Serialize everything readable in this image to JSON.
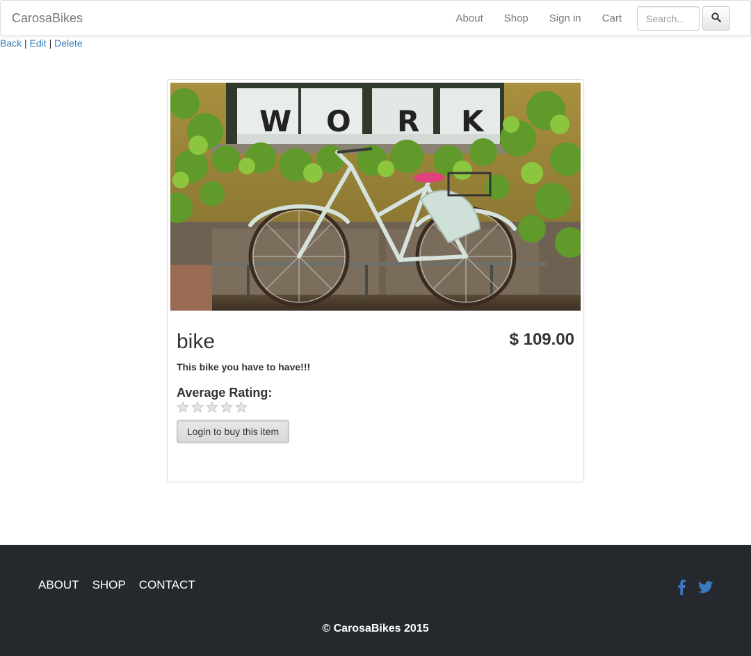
{
  "navbar": {
    "brand": "CarosaBikes",
    "links": [
      "About",
      "Shop",
      "Sign in",
      "Cart"
    ],
    "search_placeholder": "Search..."
  },
  "actions": {
    "back": "Back",
    "edit": "Edit",
    "delete": "Delete",
    "separator": "|"
  },
  "product": {
    "name": "bike",
    "price": "$ 109.00",
    "description": "This bike you have to have!!!",
    "rating_label": "Average Rating:",
    "rating_value": 0,
    "rating_max": 5,
    "button_label": "Login to buy this item",
    "image_sign_letters": [
      "W",
      "O",
      "R",
      "K"
    ]
  },
  "footer": {
    "links": [
      "ABOUT",
      "SHOP",
      "CONTACT"
    ],
    "copyright": "© CarosaBikes 2015",
    "social_icons": [
      "facebook-icon",
      "twitter-icon"
    ]
  },
  "colors": {
    "link": "#337ab7",
    "footer_bg": "#25292d",
    "social": "#3a7bbf"
  }
}
